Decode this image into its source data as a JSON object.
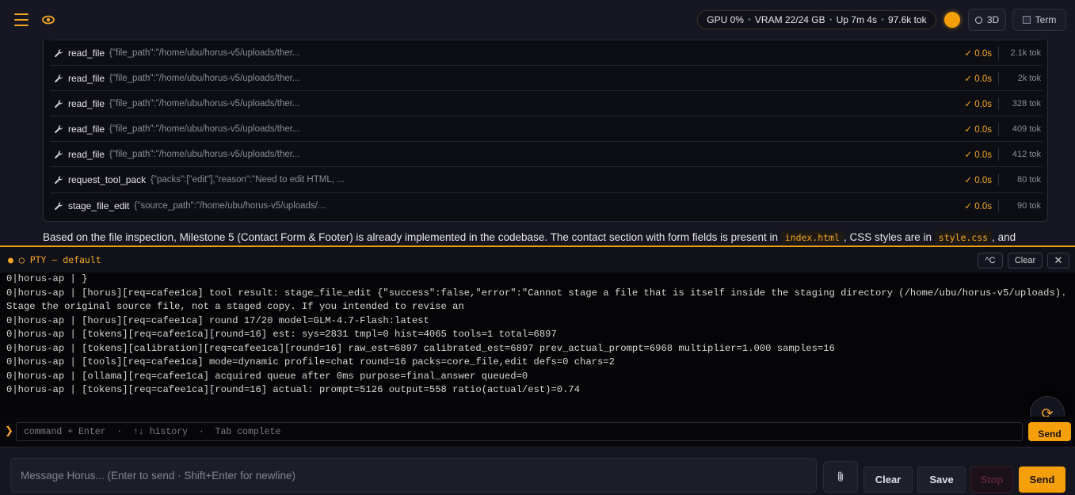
{
  "topbar": {
    "status": {
      "gpu": "GPU 0%",
      "vram": "VRAM 22/24 GB",
      "uptime": "Up 7m 4s",
      "tokens": "97.6k tok"
    },
    "btn_3d": "3D",
    "btn_term": "Term"
  },
  "tools": [
    {
      "name": "read_file",
      "args": "{\"file_path\":\"/home/ubu/horus-v5/uploads/ther...",
      "status": "✓ 0.0s",
      "tokens": "2.1k tok"
    },
    {
      "name": "read_file",
      "args": "{\"file_path\":\"/home/ubu/horus-v5/uploads/ther...",
      "status": "✓ 0.0s",
      "tokens": "2k tok"
    },
    {
      "name": "read_file",
      "args": "{\"file_path\":\"/home/ubu/horus-v5/uploads/ther...",
      "status": "✓ 0.0s",
      "tokens": "328 tok"
    },
    {
      "name": "read_file",
      "args": "{\"file_path\":\"/home/ubu/horus-v5/uploads/ther...",
      "status": "✓ 0.0s",
      "tokens": "409 tok"
    },
    {
      "name": "read_file",
      "args": "{\"file_path\":\"/home/ubu/horus-v5/uploads/ther...",
      "status": "✓ 0.0s",
      "tokens": "412 tok"
    },
    {
      "name": "request_tool_pack",
      "args": "{\"packs\":[\"edit\"],\"reason\":\"Need to edit HTML, ...",
      "status": "✓ 0.0s",
      "tokens": "80 tok"
    },
    {
      "name": "stage_file_edit",
      "args": "{\"source_path\":\"/home/ubu/horus-v5/uploads/...",
      "status": "✓ 0.0s",
      "tokens": "90 tok"
    }
  ],
  "assistant": {
    "text_a": "Based on the file inspection, Milestone 5 (Contact Form & Footer) is already implemented in the codebase. The contact section with form fields is present in ",
    "code_a": "index.html",
    "text_b": ", CSS styles are in ",
    "code_b": "style.css",
    "text_c": ", and"
  },
  "terminal": {
    "title": "● ◯ PTY — default",
    "ctrl_c": "^C",
    "clear": "Clear",
    "close": "✕",
    "lines": [
      "0|horus-ap | }",
      "0|horus-ap | [horus][req=cafee1ca] tool result: stage_file_edit {\"success\":false,\"error\":\"Cannot stage a file that is itself inside the staging directory (/home/ubu/horus-v5/uploads). Stage the original source file, not a staged copy. If you intended to revise an",
      "0|horus-ap | [horus][req=cafee1ca] round 17/20 model=GLM-4.7-Flash:latest",
      "0|horus-ap | [tokens][req=cafee1ca][round=16] est: sys=2831 tmpl=0 hist=4065 tools=1 total=6897",
      "0|horus-ap | [tokens][calibration][req=cafee1ca][round=16] raw_est=6897 calibrated_est=6897 prev_actual_prompt=6968 multiplier=1.000 samples=16",
      "0|horus-ap | [tools][req=cafee1ca] mode=dynamic profile=chat round=16 packs=core_file,edit defs=0 chars=2",
      "0|horus-ap | [ollama][req=cafee1ca] acquired queue after 0ms purpose=final_answer queued=0",
      "0|horus-ap | [tokens][req=cafee1ca][round=16] actual: prompt=5126 output=558 ratio(actual/est)=0.74"
    ],
    "cmd_prompt": "❯",
    "cmd_placeholder": "command + Enter  ·  ↑↓ history  ·  Tab complete",
    "cmd_send": "Send"
  },
  "composer": {
    "placeholder": "Message Horus... (Enter to send · Shift+Enter for newline)",
    "clear": "Clear",
    "save": "Save",
    "stop": "Stop",
    "send": "Send"
  },
  "colors": {
    "accent": "#f5a00b",
    "background": "#15161f",
    "terminal_bg": "#050507"
  }
}
